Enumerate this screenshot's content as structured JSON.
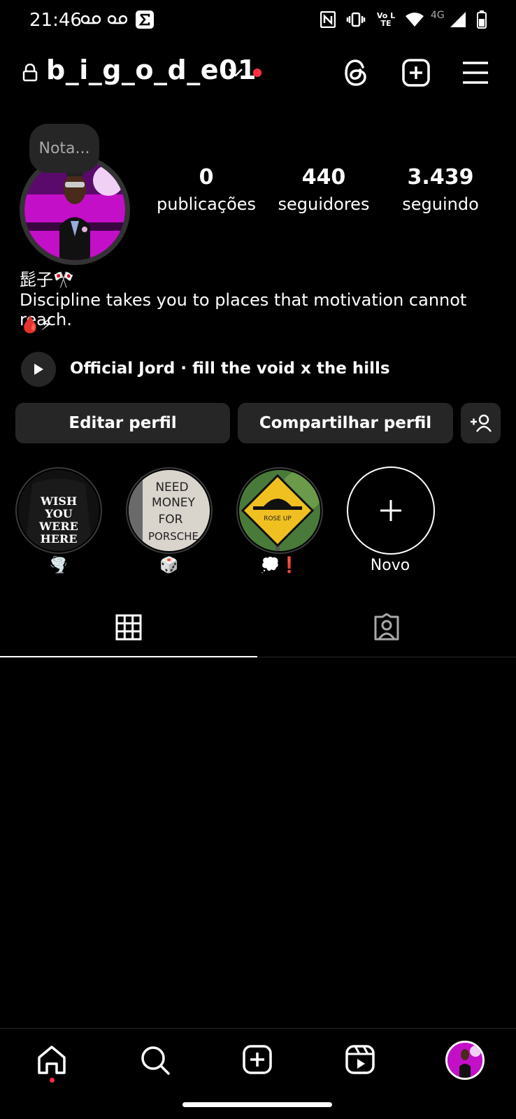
{
  "status_bar": {
    "time": "21:46",
    "network_label": "4G",
    "volte_label": "Vo LTE"
  },
  "header": {
    "username": "b_i_g_o_d_e01"
  },
  "profile": {
    "note_placeholder": "Nota...",
    "stats": [
      {
        "value": "0",
        "label": "publicações"
      },
      {
        "value": "440",
        "label": "seguidores"
      },
      {
        "value": "3.439",
        "label": "seguindo"
      }
    ],
    "display_name": "髭子🎌",
    "bio": "Discipline takes you to places that motivation cannot reach.",
    "bio_emojis": "🩸⚡",
    "music": "Official Jord · fill the void x the hills"
  },
  "buttons": {
    "edit_profile": "Editar perfil",
    "share_profile": "Compartilhar perfil"
  },
  "highlights": [
    {
      "label": "🌪️",
      "cover_text": "WISH YOU WERE HERE"
    },
    {
      "label": "🎲",
      "cover_text": "NEED MONEY FOR PORSCHE"
    },
    {
      "label": "💭❗",
      "cover_text": ""
    },
    {
      "label": "Novo"
    }
  ],
  "tabs": [
    {
      "name": "grid",
      "active": true
    },
    {
      "name": "tagged",
      "active": false
    }
  ],
  "colors": {
    "background": "#000000",
    "button_bg": "#262626",
    "notification_dot": "#ff3040",
    "avatar_bg": "#d51ad8"
  }
}
